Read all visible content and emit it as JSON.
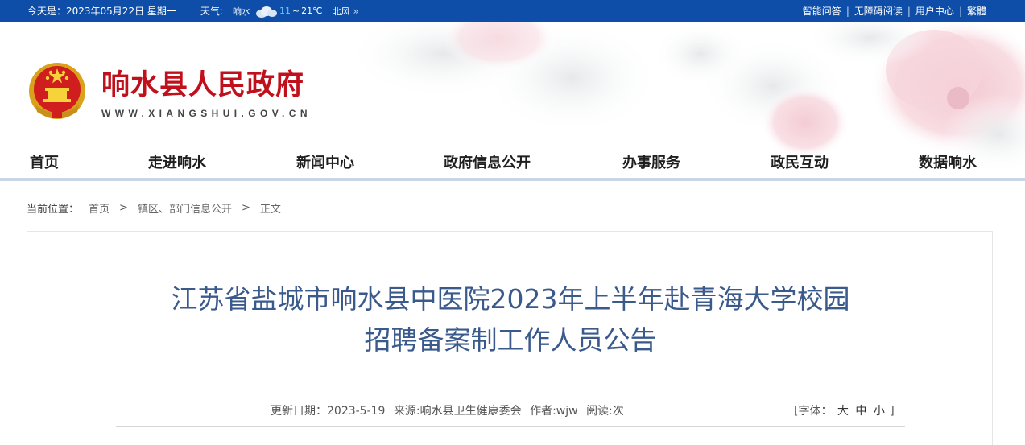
{
  "topbar": {
    "date": "今天是：2023年05月22日 星期一",
    "weather_label": "天气:",
    "weather_city": "响水",
    "weather_icon": "cloud-icon",
    "temp_low": "11",
    "temp_sep": "~",
    "temp_high": "21℃",
    "wind": "北风",
    "more": "»",
    "links": [
      "智能问答",
      "无障碍阅读",
      "用户中心",
      "繁體"
    ],
    "separator": "|",
    "bg_color": "#0e4ea8"
  },
  "header": {
    "emblem_icon": "national-emblem-icon",
    "title": "响水县人民政府",
    "url": "WWW.XIANGSHUI.GOV.CN",
    "title_color": "#c0101c"
  },
  "nav": {
    "items": [
      "首页",
      "走进响水",
      "新闻中心",
      "政府信息公开",
      "办事服务",
      "政民互动",
      "数据响水"
    ]
  },
  "breadcrumb": {
    "label": "当前位置：",
    "items": [
      "首页",
      "镇区、部门信息公开",
      "正文"
    ],
    "separator": ">"
  },
  "article": {
    "title_line1": "江苏省盐城市响水县中医院2023年上半年赴青海大学校园",
    "title_line2": "招聘备案制工作人员公告",
    "title_color": "#3a5a8c",
    "meta": {
      "updated": "更新日期：2023-5-19",
      "source": "来源:响水县卫生健康委会",
      "author": "作者:wjw",
      "reads": "阅读:次"
    },
    "font_size": {
      "label": "[字体：",
      "options": [
        "大",
        "中",
        "小"
      ],
      "close": "]"
    }
  }
}
